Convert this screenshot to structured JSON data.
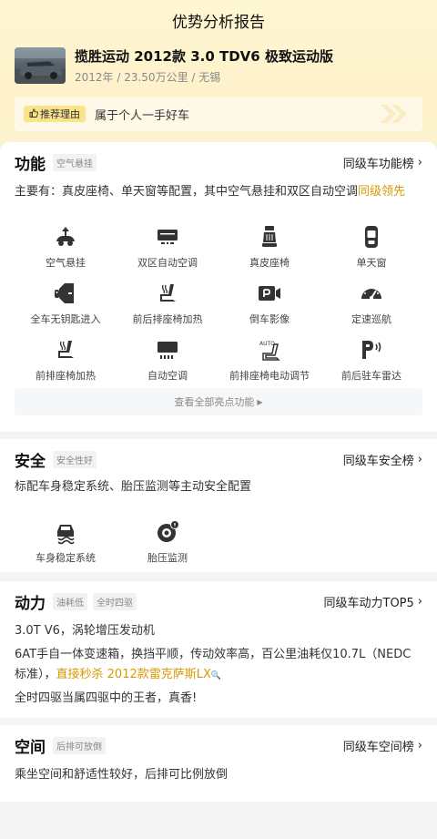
{
  "header": {
    "title": "优势分析报告"
  },
  "car": {
    "name": "揽胜运动 2012款 3.0 TDV6 极致运动版",
    "meta": "2012年 / 23.50万公里 / 无锡"
  },
  "reason": {
    "tag": "推荐理由",
    "text": "属于个人一手好车"
  },
  "function": {
    "title": "功能",
    "tag": "空气悬挂",
    "rank": "同级车功能榜",
    "desc_prefix": "主要有：真皮座椅、单天窗等配置，其中空气悬挂和双区自动空调",
    "desc_highlight": "同级领先",
    "features": [
      {
        "label": "空气悬挂",
        "icon": "air-suspension-icon"
      },
      {
        "label": "双区自动空调",
        "icon": "dual-zone-ac-icon"
      },
      {
        "label": "真皮座椅",
        "icon": "leather-seat-icon"
      },
      {
        "label": "单天窗",
        "icon": "sunroof-icon"
      },
      {
        "label": "全车无钥匙进入",
        "icon": "keyless-entry-icon"
      },
      {
        "label": "前后排座椅加热",
        "icon": "seat-heating-icon"
      },
      {
        "label": "倒车影像",
        "icon": "reverse-camera-icon"
      },
      {
        "label": "定速巡航",
        "icon": "cruise-control-icon"
      },
      {
        "label": "前排座椅加热",
        "icon": "front-seat-heating-icon"
      },
      {
        "label": "自动空调",
        "icon": "auto-ac-icon"
      },
      {
        "label": "前排座椅电动调节",
        "icon": "power-seat-icon"
      },
      {
        "label": "前后驻车雷达",
        "icon": "parking-radar-icon"
      }
    ],
    "see_all": "查看全部亮点功能"
  },
  "safety": {
    "title": "安全",
    "tag": "安全性好",
    "rank": "同级车安全榜",
    "desc": "标配车身稳定系统、胎压监测等主动安全配置",
    "features": [
      {
        "label": "车身稳定系统",
        "icon": "stability-system-icon"
      },
      {
        "label": "胎压监测",
        "icon": "tire-pressure-icon"
      }
    ]
  },
  "power": {
    "title": "动力",
    "tags": [
      "油耗低",
      "全时四驱"
    ],
    "rank": "同级车动力TOP5",
    "line1": "3.0T V6，涡轮增压发动机",
    "line2_a": "6AT手自一体变速箱，换挡平顺，传动效率高，百公里油耗仅10.7L（NEDC",
    "line2_b": "标准），",
    "line2_link": "直接秒杀 2012款雷克萨斯LX",
    "line3": "全时四驱当属四驱中的王者，真香!"
  },
  "space": {
    "title": "空间",
    "tag": "后排可放倒",
    "rank": "同级车空间榜",
    "desc": "乘坐空间和舒适性较好，后排可比例放倒"
  }
}
